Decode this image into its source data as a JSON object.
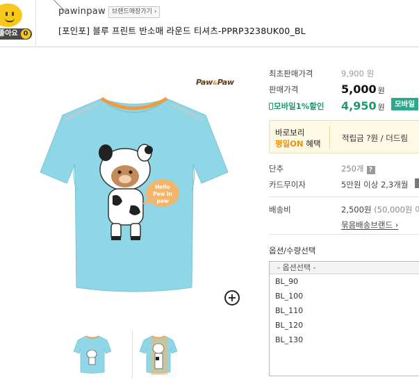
{
  "header": {
    "like_label": "좋아요",
    "like_count": "0",
    "brand_name": "pawinpaw",
    "brand_store_button": "브랜드매장가기 ›",
    "product_title": "[포인포] 블루 프린트 반소매 라운드 티셔츠-PPRP3238UK00_BL"
  },
  "image": {
    "brand_logo": "PawⓘPaw",
    "shirt_text": "Hello Paw in paw",
    "zoom_label": "+"
  },
  "price": {
    "original_label": "최초판매가격",
    "original_value": "9,900 원",
    "sale_label": "판매가격",
    "sale_value": "5,000",
    "currency": "원",
    "mobile_label": "모바일1%할인",
    "mobile_value": "4,950",
    "mobile_button": "모바일"
  },
  "benefit": {
    "line1": "바로보리",
    "line2_prefix": "평일",
    "line2_highlight": "ON",
    "line2_suffix": " 혜택",
    "points": "적립금 ?원 / 더드림"
  },
  "details": {
    "unit_label": "단추",
    "unit_value": "250개",
    "installment_label": "카드무이자",
    "installment_value": "5만원 이상 2,3개월",
    "shipping_label": "배송비",
    "shipping_value": "2,500원",
    "shipping_note": "(50,000원 이",
    "bundle_link": "묶음배송브랜드 ›"
  },
  "options": {
    "title": "옵션/수량선택",
    "placeholder": "- 옵션선택 -",
    "items": [
      "BL_90",
      "BL_100",
      "BL_110",
      "BL_120",
      "BL_130"
    ]
  },
  "colors": {
    "accent_green": "#2aa98b",
    "shirt_blue": "#8fd7e6",
    "like_yellow": "#f7c81b"
  }
}
